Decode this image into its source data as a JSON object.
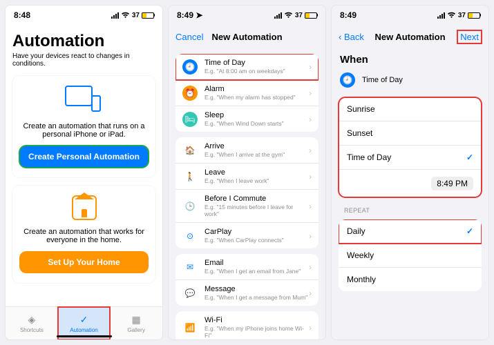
{
  "s1": {
    "time": "8:48",
    "battery": "37",
    "title": "Automation",
    "subtitle": "Have your devices react to changes in conditions.",
    "card1_text": "Create an automation that runs on a personal iPhone or iPad.",
    "card1_btn": "Create Personal Automation",
    "card2_text": "Create an automation that works for everyone in the home.",
    "card2_btn": "Set Up Your Home",
    "tabs": {
      "shortcuts": "Shortcuts",
      "automation": "Automation",
      "gallery": "Gallery"
    }
  },
  "s2": {
    "time": "8:49",
    "battery": "37",
    "nav_cancel": "Cancel",
    "nav_title": "New Automation",
    "g1": [
      {
        "title": "Time of Day",
        "sub": "E.g. \"At 8:00 am on weekdays\"",
        "color": "#007aff",
        "round": true
      },
      {
        "title": "Alarm",
        "sub": "E.g. \"When my alarm has stopped\"",
        "color": "#ff9500",
        "round": true
      },
      {
        "title": "Sleep",
        "sub": "E.g. \"When Wind Down starts\"",
        "color": "#34c7b5",
        "round": true
      }
    ],
    "g2": [
      {
        "title": "Arrive",
        "sub": "E.g. \"When I arrive at the gym\"",
        "color": "#007aff"
      },
      {
        "title": "Leave",
        "sub": "E.g. \"When I leave work\"",
        "color": "#8e8e93"
      },
      {
        "title": "Before I Commute",
        "sub": "E.g. \"15 minutes before I leave for work\"",
        "color": "#34c759"
      },
      {
        "title": "CarPlay",
        "sub": "E.g. \"When CarPlay connects\"",
        "color": "#007aff"
      }
    ],
    "g3": [
      {
        "title": "Email",
        "sub": "E.g. \"When I get an email from Jane\"",
        "color": "#0a84ff"
      },
      {
        "title": "Message",
        "sub": "E.g. \"When I get a message from Mum\"",
        "color": "#30d158"
      }
    ],
    "g4": [
      {
        "title": "Wi-Fi",
        "sub": "E.g. \"When my iPhone joins home Wi-Fi\"",
        "color": "#007aff"
      }
    ]
  },
  "s3": {
    "time": "8:49",
    "battery": "37",
    "nav_back": "Back",
    "nav_title": "New Automation",
    "nav_next": "Next",
    "when": "When",
    "trigger": "Time of Day",
    "opts": {
      "sunrise": "Sunrise",
      "sunset": "Sunset",
      "tod": "Time of Day",
      "time": "8:49 PM"
    },
    "repeat_lbl": "REPEAT",
    "repeat": {
      "daily": "Daily",
      "weekly": "Weekly",
      "monthly": "Monthly"
    }
  }
}
